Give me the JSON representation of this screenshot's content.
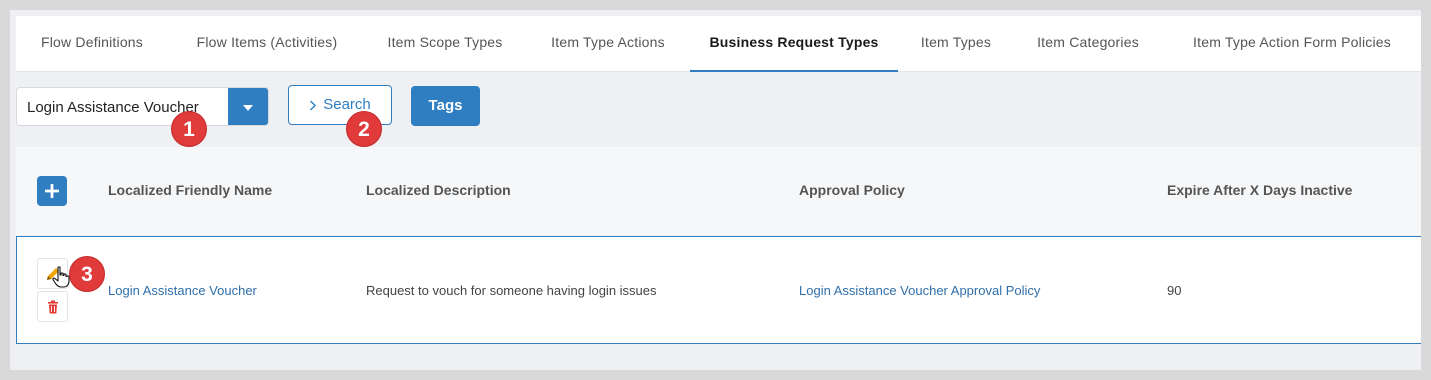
{
  "tabs": [
    {
      "label": "Flow Definitions",
      "active": false
    },
    {
      "label": "Flow Items (Activities)",
      "active": false
    },
    {
      "label": "Item Scope Types",
      "active": false
    },
    {
      "label": "Item Type Actions",
      "active": false
    },
    {
      "label": "Business Request Types",
      "active": true
    },
    {
      "label": "Item Types",
      "active": false
    },
    {
      "label": "Item Categories",
      "active": false
    },
    {
      "label": "Item Type Action Form Policies",
      "active": false
    }
  ],
  "toolbar": {
    "selected_type": "Login Assistance Voucher",
    "search_label": "Search",
    "tags_label": "Tags"
  },
  "badges": {
    "one": "1",
    "two": "2",
    "three": "3"
  },
  "table": {
    "columns": [
      "Localized Friendly Name",
      "Localized Description",
      "Approval Policy",
      "Expire After X Days Inactive"
    ],
    "rows": [
      {
        "name": "Login Assistance Voucher",
        "description": "Request to vouch for someone having login issues",
        "approval_policy": "Login Assistance Voucher Approval Policy",
        "expire_days": "90"
      }
    ]
  },
  "icons": {
    "dropdown": "caret-down-icon",
    "search": "chevron-right-icon",
    "add": "plus-icon",
    "edit": "pencil-icon",
    "delete": "trash-icon",
    "cursor": "hand-pointer-icon"
  },
  "colors": {
    "accent": "#2f7ec1",
    "badge": "#e03a3a",
    "delete": "#e53935",
    "edit": "#f0a500"
  }
}
